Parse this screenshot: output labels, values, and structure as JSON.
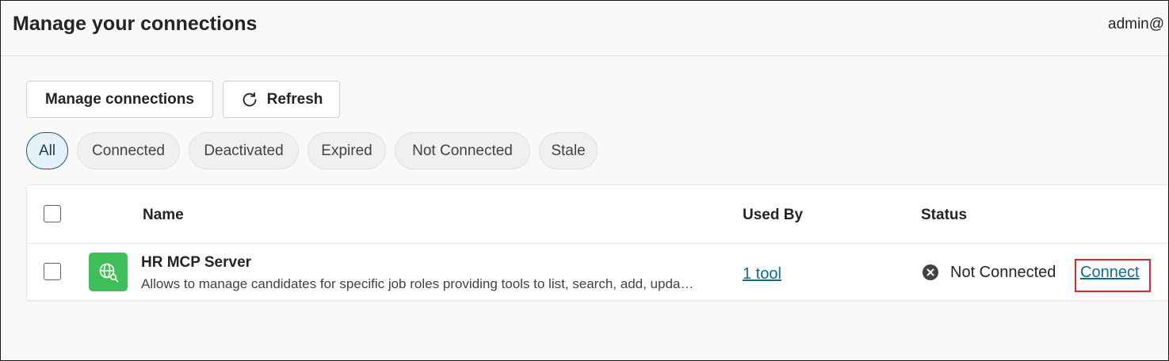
{
  "header": {
    "title": "Manage your connections",
    "user": "admin@"
  },
  "toolbar": {
    "manage_label": "Manage connections",
    "refresh_label": "Refresh"
  },
  "filters": [
    {
      "label": "All",
      "active": true
    },
    {
      "label": "Connected",
      "active": false
    },
    {
      "label": "Deactivated",
      "active": false
    },
    {
      "label": "Expired",
      "active": false
    },
    {
      "label": "Not Connected",
      "active": false
    },
    {
      "label": "Stale",
      "active": false
    }
  ],
  "table": {
    "columns": {
      "name": "Name",
      "used_by": "Used By",
      "status": "Status"
    },
    "rows": [
      {
        "icon": "globe-search-icon",
        "name": "HR MCP Server",
        "description": "Allows to manage candidates for specific job roles providing tools to list, search, add, upda…",
        "used_by": "1 tool",
        "status": "Not Connected",
        "action": "Connect"
      }
    ]
  },
  "colors": {
    "accent": "#0f6c8c",
    "icon_bg": "#3fbf5a",
    "highlight": "#d9262d"
  }
}
